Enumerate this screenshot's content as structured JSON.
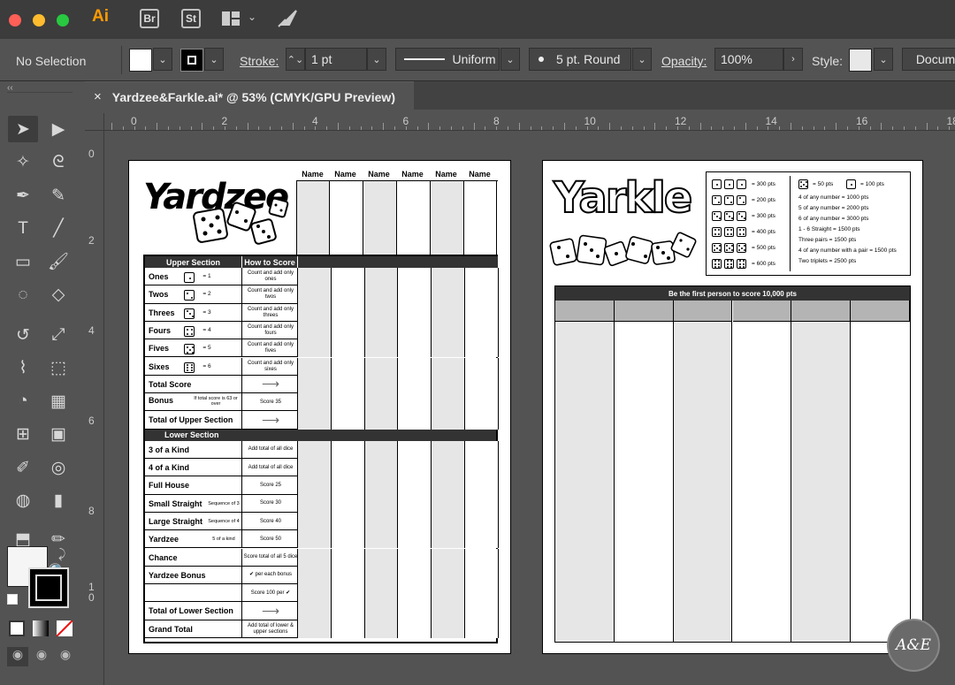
{
  "app": {
    "name": "Ai",
    "bridge": "Br",
    "stock": "St",
    "window_buttons": {
      "close": "#fe5f57",
      "minimize": "#febc2e",
      "maximize": "#28c840"
    },
    "accent": "#ff9a00"
  },
  "control_bar": {
    "selection": "No Selection",
    "stroke_label": "Stroke:",
    "stroke_value": "1 pt",
    "profile": "Uniform",
    "brush": "5 pt. Round",
    "opacity_label": "Opacity:",
    "opacity_value": "100%",
    "style_label": "Style:",
    "document_setup": "Docum"
  },
  "tab": {
    "close": "×",
    "title": "Yardzee&Farkle.ai* @ 53% (CMYK/GPU Preview)"
  },
  "rulers": {
    "horizontal": [
      "0",
      "2",
      "4",
      "6",
      "8",
      "10",
      "12",
      "14",
      "16",
      "18"
    ],
    "vertical": [
      "0",
      "2",
      "4",
      "6",
      "8",
      "1\n0"
    ]
  },
  "tools": [
    "selection-tool",
    "direct-selection-tool",
    "magic-wand-tool",
    "lasso-tool",
    "pen-tool",
    "curvature-tool",
    "type-tool",
    "line-tool",
    "rectangle-tool",
    "paintbrush-tool",
    "shaper-tool",
    "eraser-tool",
    "rotate-tool",
    "scale-tool",
    "warp-tool",
    "free-transform-tool",
    "shape-builder-tool",
    "perspective-grid-tool",
    "mesh-tool",
    "gradient-tool",
    "eyedropper-tool",
    "blend-tool",
    "symbol-sprayer-tool",
    "column-graph-tool",
    "artboard-tool",
    "slice-tool",
    "hand-tool",
    "zoom-tool"
  ],
  "yardzee": {
    "title": "Yardzee",
    "names": [
      "Name",
      "Name",
      "Name",
      "Name",
      "Name",
      "Name"
    ],
    "upper_header": "Upper Section",
    "how_header": "How to Score",
    "upper_rows": [
      {
        "label": "Ones",
        "die": 1,
        "eq": "= 1",
        "how": "Count and add only ones"
      },
      {
        "label": "Twos",
        "die": 2,
        "eq": "= 2",
        "how": "Count and add only twos"
      },
      {
        "label": "Threes",
        "die": 3,
        "eq": "= 3",
        "how": "Count and add only threes"
      },
      {
        "label": "Fours",
        "die": 4,
        "eq": "= 4",
        "how": "Count and add only fours"
      },
      {
        "label": "Fives",
        "die": 5,
        "eq": "= 5",
        "how": "Count and add only fives"
      },
      {
        "label": "Sixes",
        "die": 6,
        "eq": "= 6",
        "how": "Count and add only sixes"
      },
      {
        "label": "Total Score",
        "how": "→"
      },
      {
        "label": "Bonus",
        "sub": "If total score is 63 or over",
        "how": "Score 35"
      },
      {
        "label": "Total of Upper Section",
        "how": "→"
      }
    ],
    "lower_header": "Lower Section",
    "lower_rows": [
      {
        "label": "3 of a Kind",
        "how": "Add total of all dice"
      },
      {
        "label": "4 of a Kind",
        "how": "Add total of all dice"
      },
      {
        "label": "Full House",
        "how": "Score 25"
      },
      {
        "label": "Small Straight",
        "sub": "Sequence of 3",
        "how": "Score 30"
      },
      {
        "label": "Large Straight",
        "sub": "Sequence of 4",
        "how": "Score 40"
      },
      {
        "label": "Yardzee",
        "sub": "5 of a kind",
        "how": "Score 50"
      },
      {
        "label": "Chance",
        "how": "Score total of all 5 dice"
      },
      {
        "label": "Yardzee Bonus",
        "how": "✔ per each bonus"
      },
      {
        "label": "",
        "how": "Score 100 per ✔"
      },
      {
        "label": "Total of Lower Section",
        "how": "→"
      },
      {
        "label": "Grand Total",
        "how": "Add total of lower & upper sections"
      }
    ]
  },
  "yarkle": {
    "title": "Yarkle",
    "scoring_left": [
      {
        "dice": [
          1,
          1,
          1
        ],
        "pts": "= 300 pts"
      },
      {
        "dice": [
          2,
          2,
          2
        ],
        "pts": "= 200 pts"
      },
      {
        "dice": [
          3,
          3,
          3
        ],
        "pts": "= 300 pts"
      },
      {
        "dice": [
          4,
          4,
          4
        ],
        "pts": "= 400 pts"
      },
      {
        "dice": [
          5,
          5,
          5
        ],
        "pts": "= 500 pts"
      },
      {
        "dice": [
          6,
          6,
          6
        ],
        "pts": "= 600 pts"
      }
    ],
    "scoring_singles": [
      {
        "die": 5,
        "pts": "= 50 pts"
      },
      {
        "die": 1,
        "pts": "= 100 pts"
      }
    ],
    "scoring_right": [
      "4 of any number = 1000 pts",
      "5 of any number = 2000 pts",
      "6 of any number = 3000 pts",
      "1 - 6 Straight = 1500 pts",
      "Three pairs = 1500 pts",
      "4 of any number with a pair = 1500 pts",
      "Two triplets = 2500 pts"
    ],
    "banner": "Be the first person to score 10,000 pts",
    "columns": 6
  },
  "watermark": "A&E"
}
